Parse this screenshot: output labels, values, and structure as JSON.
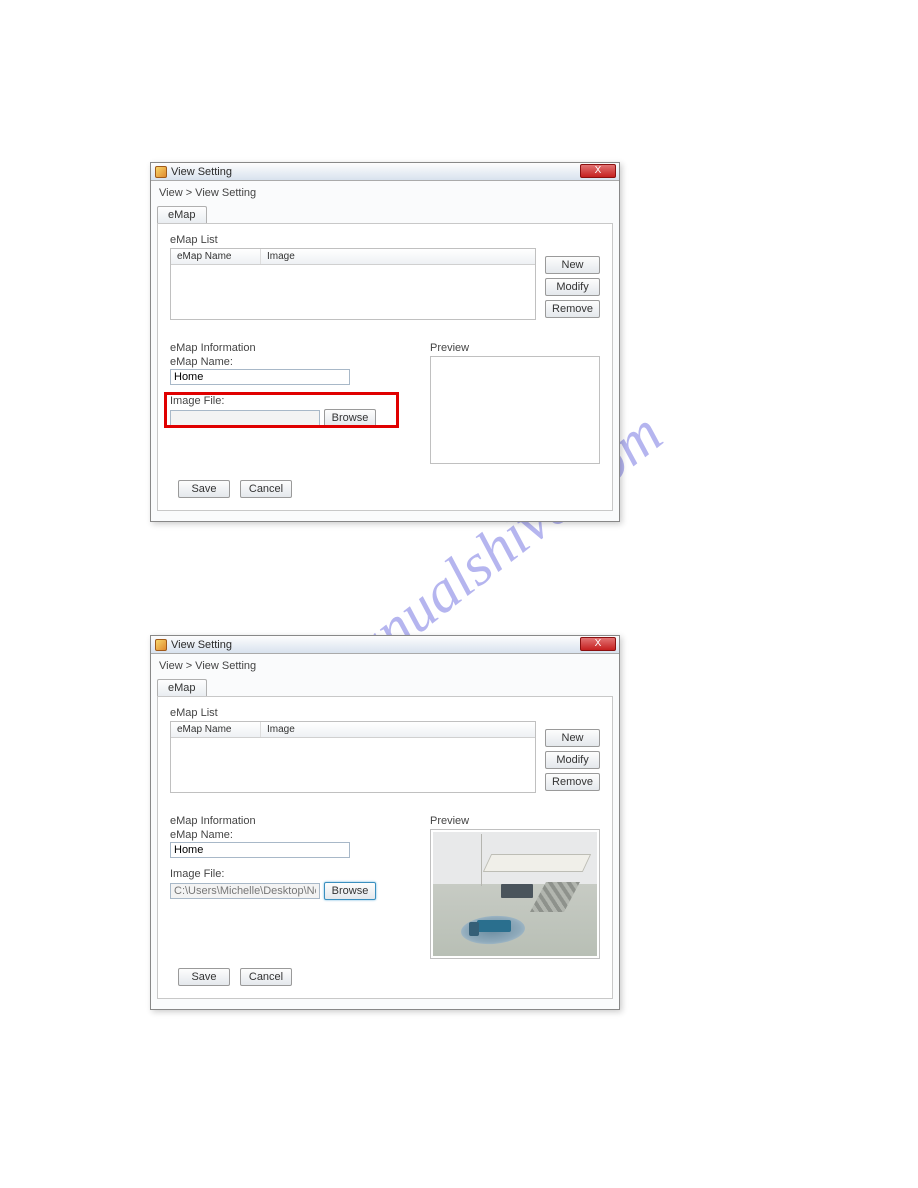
{
  "watermark": "manualshive.com",
  "window1": {
    "title": "View Setting",
    "close": "X",
    "breadcrumb": "View > View Setting",
    "tab": "eMap",
    "list_title": "eMap List",
    "columns": {
      "name": "eMap Name",
      "image": "Image"
    },
    "buttons": {
      "new": "New",
      "modify": "Modify",
      "remove": "Remove"
    },
    "info_title": "eMap Information",
    "name_label": "eMap Name:",
    "name_value": "Home",
    "file_label": "Image File:",
    "file_value": "",
    "browse": "Browse",
    "preview_label": "Preview",
    "save": "Save",
    "cancel": "Cancel"
  },
  "window2": {
    "title": "View Setting",
    "close": "X",
    "breadcrumb": "View > View Setting",
    "tab": "eMap",
    "list_title": "eMap List",
    "columns": {
      "name": "eMap Name",
      "image": "Image"
    },
    "buttons": {
      "new": "New",
      "modify": "Modify",
      "remove": "Remove"
    },
    "info_title": "eMap Information",
    "name_label": "eMap Name:",
    "name_value": "Home",
    "file_label": "Image File:",
    "file_value": "C:\\Users\\Michelle\\Desktop\\New folder",
    "browse": "Browse",
    "preview_label": "Preview",
    "save": "Save",
    "cancel": "Cancel"
  }
}
